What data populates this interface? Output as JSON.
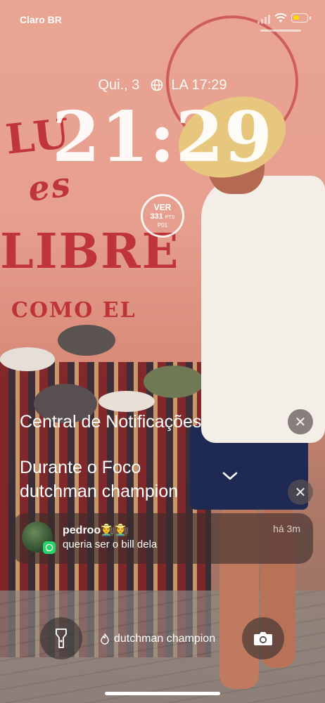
{
  "status_bar": {
    "carrier": "Claro BR",
    "battery_level": 0.45,
    "battery_color": "#ffd60a",
    "icons": [
      "signal-icon",
      "wifi-icon",
      "battery-icon"
    ]
  },
  "lock_screen": {
    "date": "Qui., 3",
    "world_clock": "LA 17:29",
    "time": "21:29",
    "widget": {
      "team": "VER",
      "points": "331",
      "points_unit": "PTS",
      "position": "P01"
    }
  },
  "notification_center": {
    "title": "Central de Notificações",
    "focus_title": "Durante o Foco",
    "focus_name": "dutchman champion"
  },
  "notification": {
    "sender": "pedroo🧑‍🌾🧑‍🌾",
    "time": "há 3m",
    "message": "queria ser o bill dela",
    "app_icon": "whatsapp-icon"
  },
  "bottom": {
    "focus_indicator": "dutchman champion",
    "left_button_icon": "flashlight-icon",
    "right_button_icon": "camera-icon"
  }
}
